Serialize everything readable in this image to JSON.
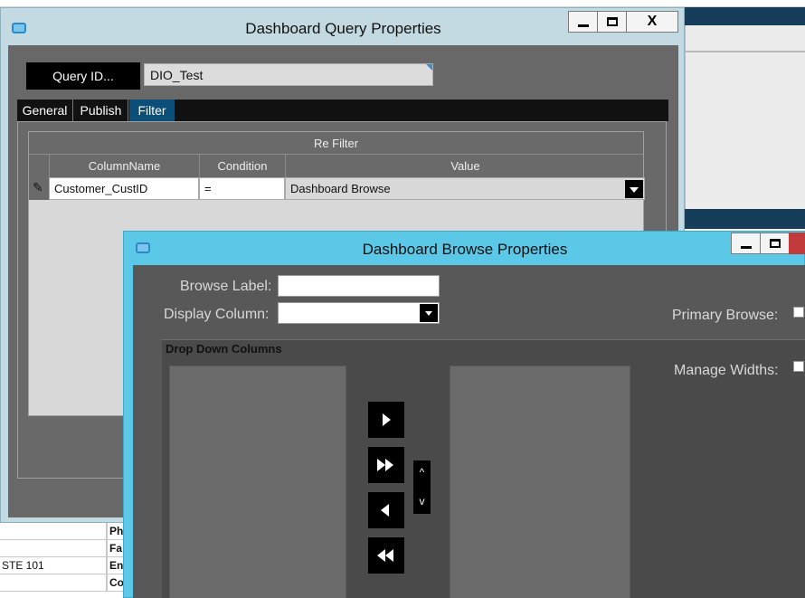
{
  "background": {
    "table_rows": [
      {
        "c1": "",
        "c2": "Ph"
      },
      {
        "c1": "",
        "c2": "Fa"
      },
      {
        "c1": "STE 101",
        "c2": "En"
      },
      {
        "c1": "",
        "c2": "Co"
      }
    ]
  },
  "query_window": {
    "title": "Dashboard Query Properties",
    "close_label": "X",
    "query_id_button": "Query ID...",
    "query_id_value": "DIO_Test",
    "tabs": [
      "General",
      "Publish",
      "Filter"
    ],
    "active_tab": "Filter",
    "grid": {
      "group_header": "Re Filter",
      "columns": [
        "ColumnName",
        "Condition",
        "Value"
      ],
      "rows": [
        {
          "column_name": "Customer_CustID",
          "condition": "=",
          "value": "Dashboard Browse"
        }
      ]
    }
  },
  "browse_window": {
    "title": "Dashboard Browse Properties",
    "browse_label": "Browse Label:",
    "browse_label_value": "",
    "display_column": "Display Column:",
    "display_column_value": "",
    "primary_browse": "Primary Browse:",
    "manage_widths": "Manage Widths:",
    "drop_down_columns": "Drop Down Columns",
    "up_label": "^",
    "down_label": "v"
  },
  "colors": {
    "query_title_bg": "#c3dae3",
    "browse_title_bg": "#5bc8e7",
    "active_tab": "#0b4f78",
    "dark_panel": "#585858"
  }
}
